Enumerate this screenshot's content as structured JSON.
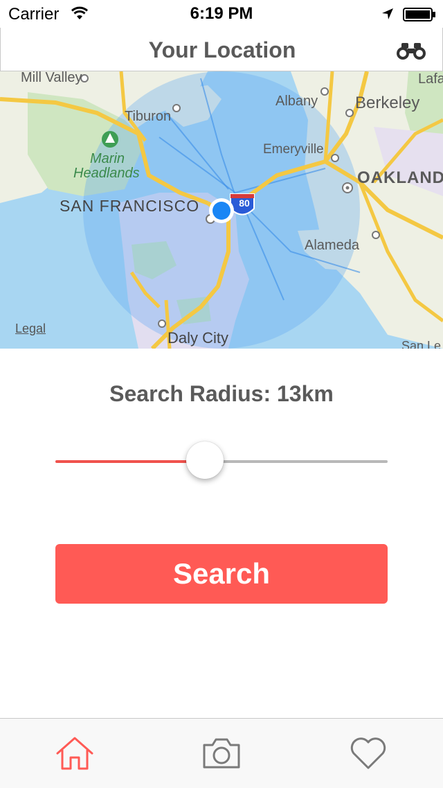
{
  "status_bar": {
    "carrier": "Carrier",
    "time": "6:19 PM"
  },
  "nav": {
    "title": "Your Location"
  },
  "map": {
    "labels": {
      "mill_valley": "Mill Valley",
      "tiburon": "Tiburon",
      "albany": "Albany",
      "berkeley": "Berkeley",
      "lafa": "Lafa",
      "marin": "Marin",
      "headlands": "Headlands",
      "emeryville": "Emeryville",
      "oakland": "OAKLAND",
      "san_francisco": "SAN FRANCISCO",
      "alameda": "Alameda",
      "daly_city": "Daly City",
      "san_le": "San Le",
      "highway": "80"
    },
    "legal": "Legal"
  },
  "radius": {
    "label": "Search Radius: 13km",
    "value_fraction": 0.455
  },
  "search_button": {
    "label": "Search"
  },
  "tabs": [
    "home-icon",
    "camera-icon",
    "heart-icon"
  ],
  "colors": {
    "accent": "#ff5a55",
    "title_text": "#5a5a5a",
    "location_dot": "#1a86f5"
  }
}
